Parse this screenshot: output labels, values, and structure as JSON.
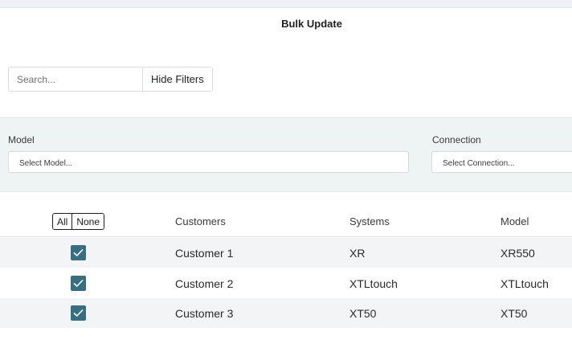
{
  "page": {
    "title": "Bulk Update"
  },
  "search": {
    "placeholder": "Search...",
    "value": ""
  },
  "toolbar": {
    "hide_filters_label": "Hide Filters"
  },
  "filters": {
    "model": {
      "label": "Model",
      "placeholder": "Select Model..."
    },
    "connection": {
      "label": "Connection",
      "placeholder": "Select Connection..."
    }
  },
  "table": {
    "select_all_label": "All",
    "select_none_label": "None",
    "columns": [
      "Customers",
      "Systems",
      "Model"
    ],
    "rows": [
      {
        "customer": "Customer 1",
        "system": "XR",
        "model": "XR550",
        "checked": true
      },
      {
        "customer": "Customer 2",
        "system": "XTLtouch",
        "model": "XTLtouch",
        "checked": true
      },
      {
        "customer": "Customer 3",
        "system": "XT50",
        "model": "XT50",
        "checked": true
      }
    ]
  },
  "colors": {
    "checkbox": "#366f84",
    "filter_panel": "#eef3f3",
    "row_stripe": "#f3f4f6"
  },
  "icons": {
    "checkbox": "checkmark-icon"
  }
}
